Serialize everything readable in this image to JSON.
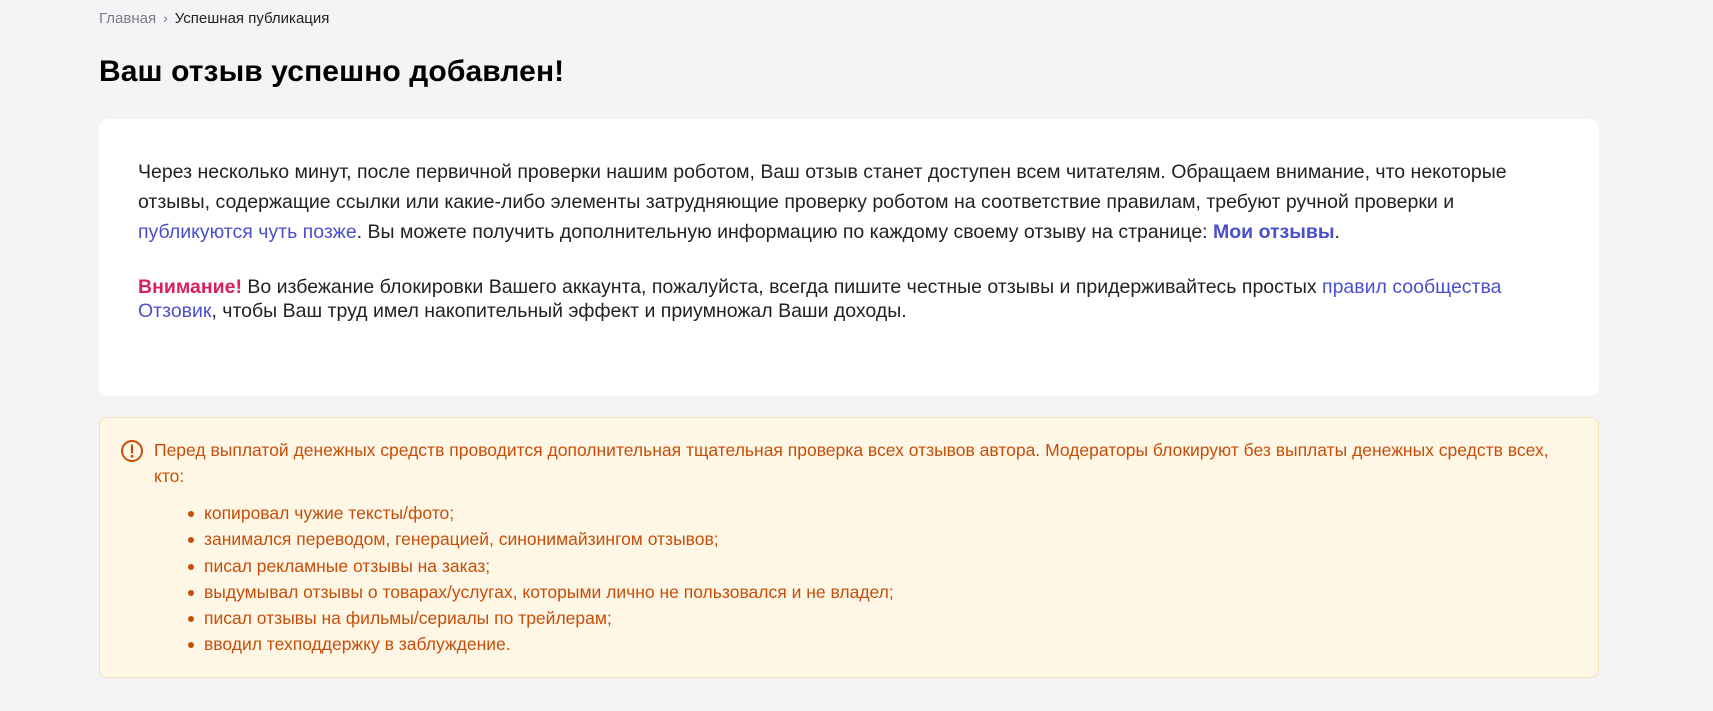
{
  "breadcrumb": {
    "home": "Главная",
    "separator": "›",
    "current": "Успешная публикация"
  },
  "title": "Ваш отзыв успешно добавлен!",
  "info": {
    "text_1": "Через несколько минут, после первичной проверки нашим роботом, Ваш отзыв станет доступен всем читателям. Обращаем внимание, что некоторые отзывы, содержащие ссылки или какие-либо элементы затрудняющие проверку роботом на соответствие правилам, требуют ручной проверки и ",
    "link_later": "публикуются чуть позже",
    "text_2": ". Вы можете получить дополнительную информацию по каждому своему отзыву на странице: ",
    "link_my_reviews": "Мои отзывы",
    "text_3": "."
  },
  "warning": {
    "label": "Внимание!",
    "text_1": " Во избежание блокировки Вашего аккаунта, пожалуйста, всегда пишите честные отзывы и придерживайтесь простых ",
    "link_rules": "правил сообщества Отзовик",
    "text_2": ", чтобы Ваш труд имел накопительный эффект и приумножал Ваши доходы."
  },
  "notice": {
    "icon": "exclamation-circle-icon",
    "intro": "Перед выплатой денежных средств проводится дополнительная тщательная проверка всех отзывов автора. Модераторы блокируют без выплаты денежных средств всех, кто:",
    "items": [
      "копировал чужие тексты/фото;",
      "занимался переводом, генерацией, синонимайзингом отзывов;",
      "писал рекламные отзывы на заказ;",
      "выдумывал отзывы о товарах/услугах, которыми лично не пользовался и не владел;",
      "писал отзывы на фильмы/сериалы по трейлерам;",
      "вводил техподдержку в заблуждение."
    ]
  },
  "colors": {
    "background": "#f4f4f6",
    "link": "#4a4fcb",
    "attention": "#d6245b",
    "notice_text": "#c64e0a",
    "notice_bg": "#fff7e6"
  }
}
